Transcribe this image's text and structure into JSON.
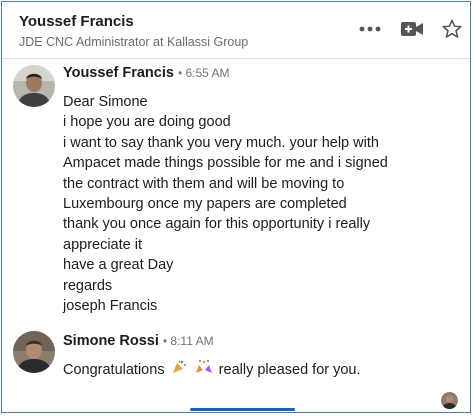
{
  "header": {
    "contact_name": "Youssef Francis",
    "contact_headline": "JDE CNC Administrator at Kallassi Group",
    "icons": [
      "more-options-icon",
      "video-call-icon",
      "star-icon"
    ]
  },
  "messages": [
    {
      "sender": "Youssef Francis",
      "time": "• 6:55 AM",
      "lines": [
        "Dear Simone",
        "i hope you are doing good",
        "i want to say thank you very much. your help with",
        "Ampacet made things possible for me and i signed",
        "the contract with them and will be moving to",
        "Luxembourg once my papers are completed",
        "thank you once again for this opportunity i really",
        "appreciate it",
        "have a great Day",
        "regards",
        "joseph Francis"
      ]
    },
    {
      "sender": "Simone Rossi",
      "time": "• 8:11 AM",
      "text_before": "Congratulations",
      "emojis": [
        "party-popper-emoji",
        "celebration-emoji"
      ],
      "text_after": "really pleased for you."
    }
  ],
  "colors": {
    "accent": "#0a66c2",
    "frame": "#4a7ab8",
    "muted": "#6b6b6b"
  }
}
